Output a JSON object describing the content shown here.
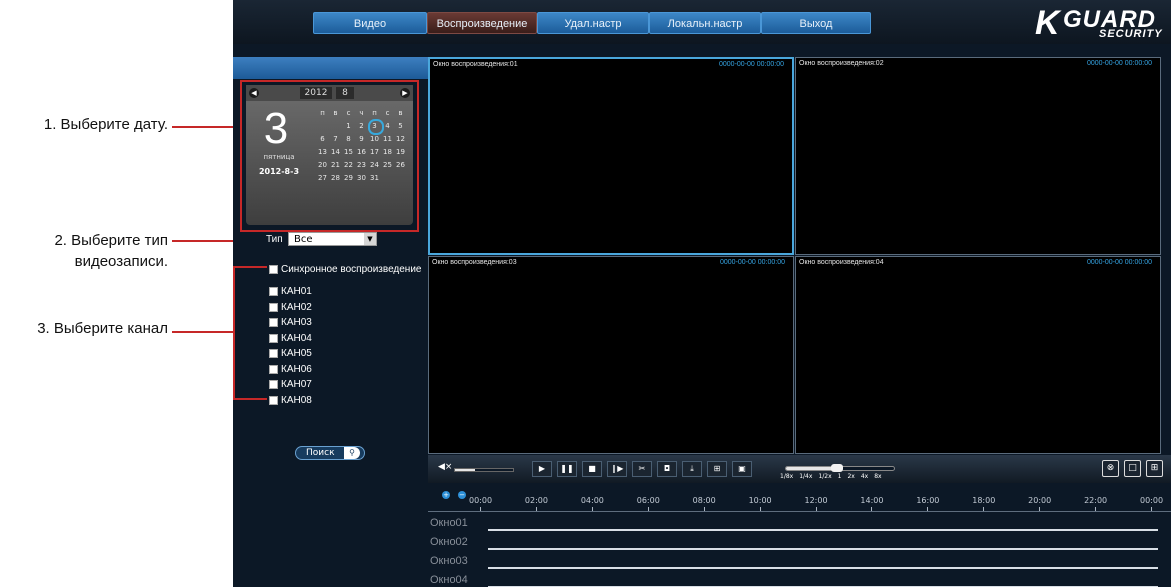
{
  "annotations": {
    "step1": "1. Выберите дату.",
    "step2_line1": "2. Выберите тип",
    "step2_line2": "видеозаписи.",
    "step3": "3. Выберите канал"
  },
  "menu": {
    "tabs": [
      "Видео",
      "Воспроизведение",
      "Удал.настр",
      "Локальн.настр",
      "Выход"
    ],
    "active_tab": "Воспроизведение"
  },
  "logo": {
    "k": "K",
    "guard": "GUARD",
    "security": "SECURITY"
  },
  "calendar": {
    "year": "2012",
    "month": "8",
    "big_day": "3",
    "weekday": "пятница",
    "date": "2012-8-3",
    "weekday_headers": [
      "п",
      "в",
      "с",
      "ч",
      "п",
      "с",
      "в"
    ],
    "weeks": [
      [
        "",
        "",
        "1",
        "2",
        "3",
        "4",
        "5"
      ],
      [
        "6",
        "7",
        "8",
        "9",
        "10",
        "11",
        "12"
      ],
      [
        "13",
        "14",
        "15",
        "16",
        "17",
        "18",
        "19"
      ],
      [
        "20",
        "21",
        "22",
        "23",
        "24",
        "25",
        "26"
      ],
      [
        "27",
        "28",
        "29",
        "30",
        "31",
        "",
        ""
      ]
    ],
    "selected_day": "3"
  },
  "filter": {
    "type_label": "Тип",
    "type_value": "Все"
  },
  "sync_label": "Синхронное воспроизведение",
  "channels": [
    "КАН01",
    "КАН02",
    "КАН03",
    "КАН04",
    "КАН05",
    "КАН06",
    "КАН07",
    "КАН08"
  ],
  "search_label": "Поиск",
  "windows": [
    {
      "title": "Окно воспроизведения:01",
      "stamp": "0000-00-00 00:00:00"
    },
    {
      "title": "Окно воспроизведения:02",
      "stamp": "0000-00-00 00:00:00"
    },
    {
      "title": "Окно воспроизведения:03",
      "stamp": "0000-00-00 00:00:00"
    },
    {
      "title": "Окно воспроизведения:04",
      "stamp": "0000-00-00 00:00:00"
    }
  ],
  "playback": {
    "speed_labels": [
      "1/8x",
      "1/4x",
      "1/2x",
      "1",
      "2x",
      "4x",
      "8x"
    ],
    "volume_level": 0.35,
    "speed_level": 0.5
  },
  "timeline": {
    "hours": [
      "00:00",
      "02:00",
      "04:00",
      "06:00",
      "08:00",
      "10:00",
      "12:00",
      "14:00",
      "16:00",
      "18:00",
      "20:00",
      "22:00",
      "00:00"
    ],
    "rows": [
      "Окно01",
      "Окно02",
      "Окно03",
      "Окно04"
    ]
  },
  "colors": {
    "accent": "#35a4e3",
    "annotation": "#c62828",
    "background": "#0c1826"
  }
}
